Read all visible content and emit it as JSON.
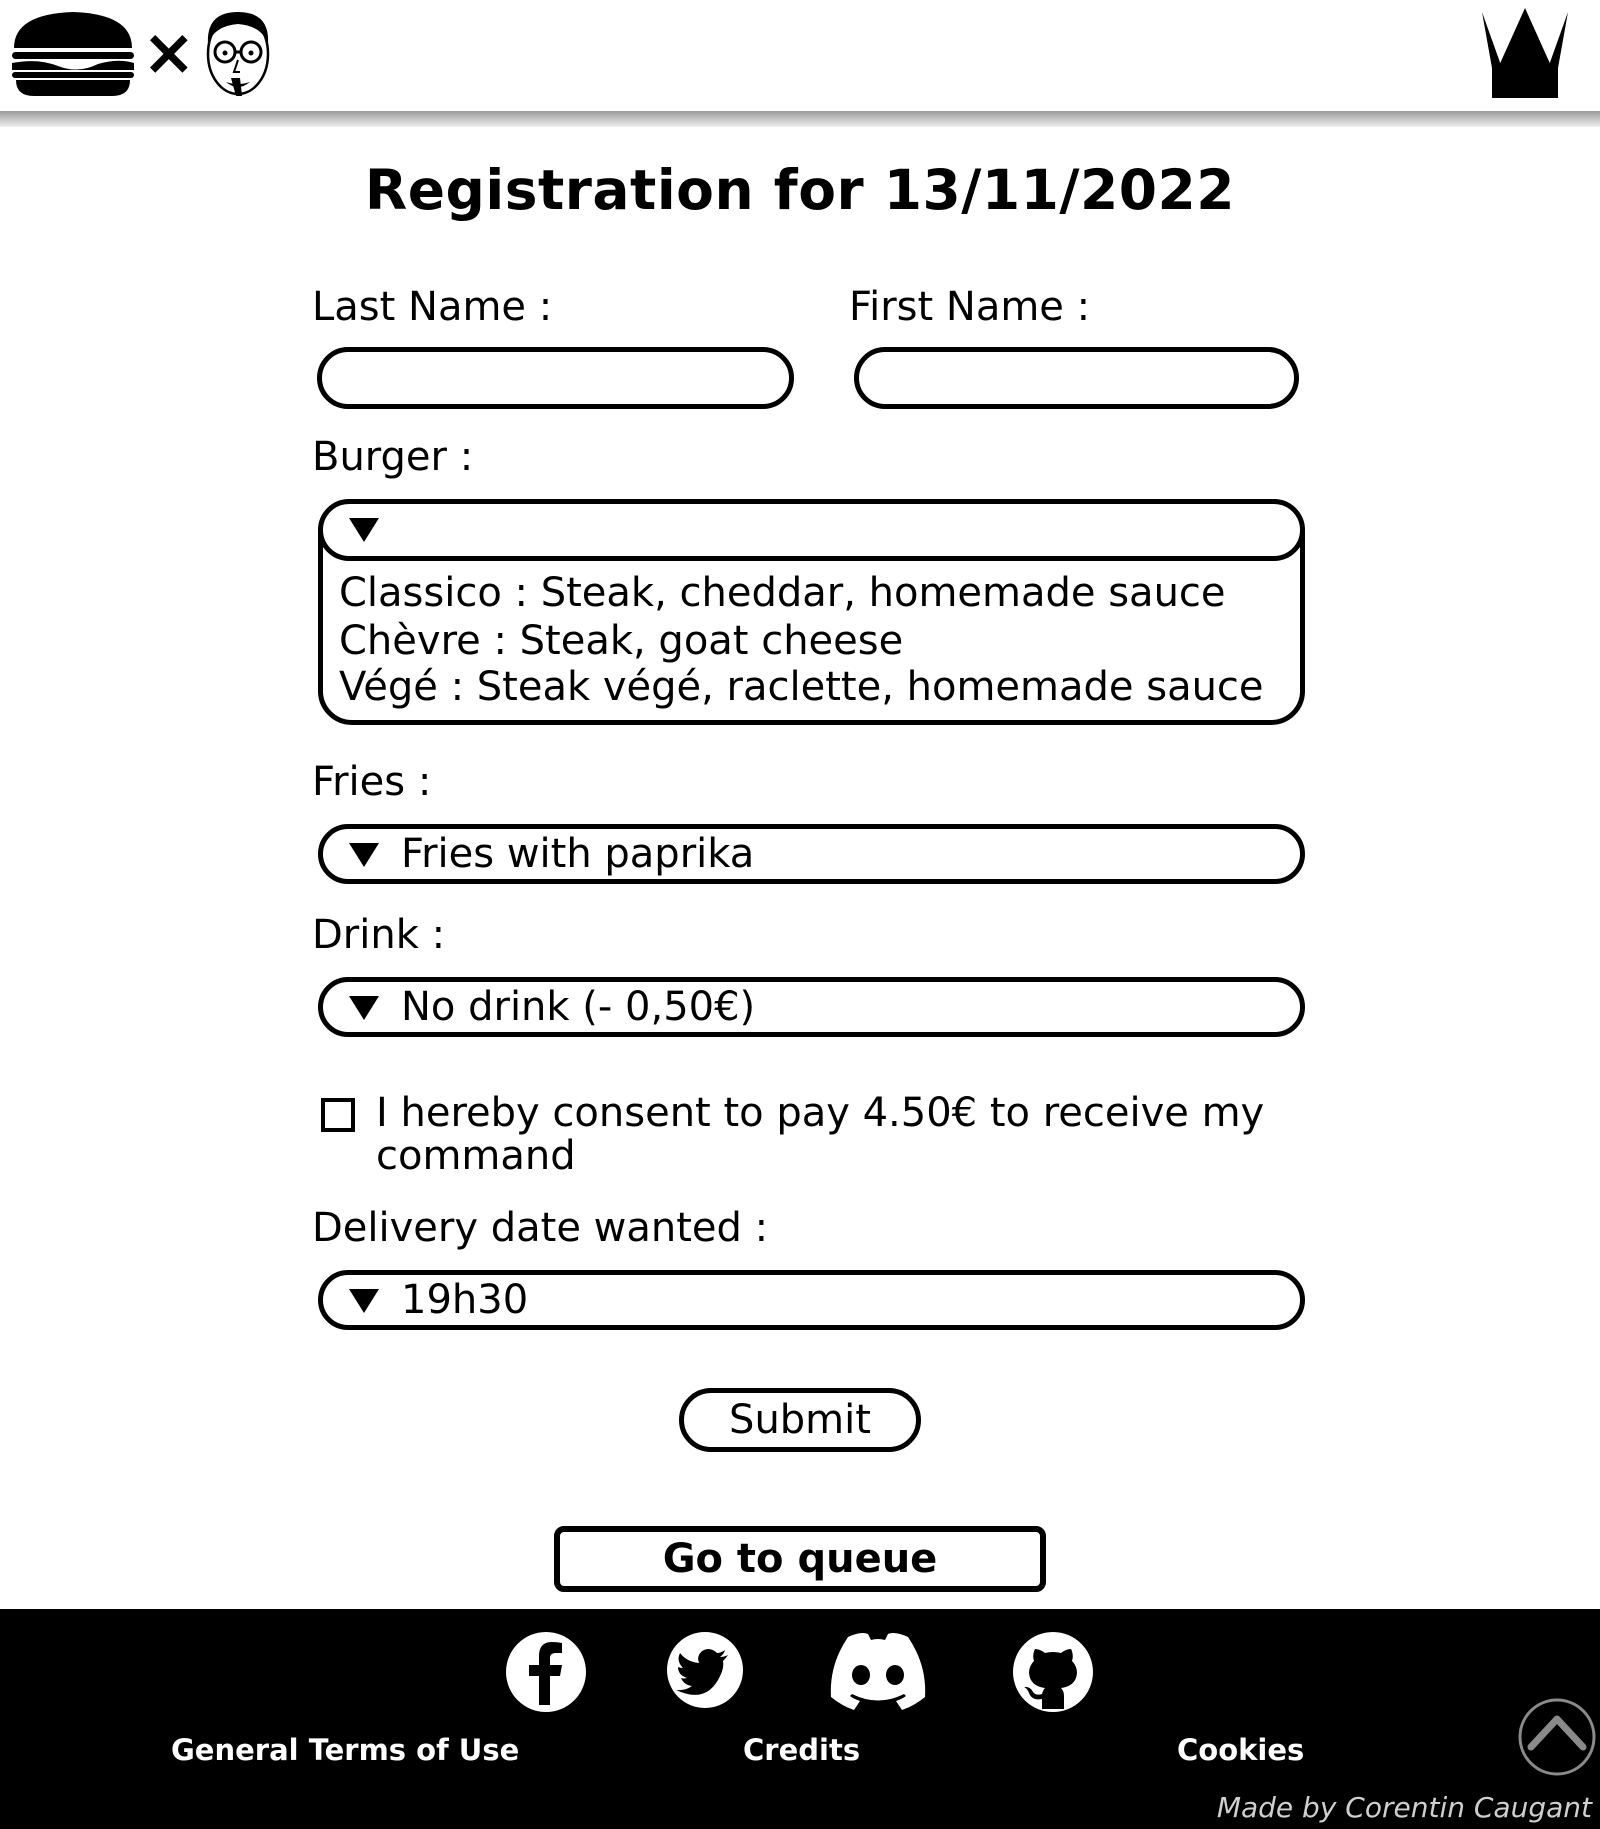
{
  "header": {
    "logo_alt": "Burger x Logo",
    "logo_separator": "×",
    "crown_icon": "crown-icon"
  },
  "form": {
    "title": "Registration for 13/11/2022",
    "last_name_label": "Last Name :",
    "first_name_label": "First Name :",
    "last_name_value": "",
    "first_name_value": "",
    "burger_label": "Burger :",
    "burger_options": [
      "Classico : Steak, cheddar, homemade sauce",
      "Chèvre : Steak, goat cheese",
      "Végé : Steak végé, raclette, homemade sauce"
    ],
    "fries_label": "Fries :",
    "fries_value": "Fries with paprika",
    "drink_label": "Drink :",
    "drink_value": "No drink (- 0,50€)",
    "consent_text": "I hereby consent to pay 4.50€ to receive my command",
    "consent_checked": false,
    "delivery_label": "Delivery date wanted :",
    "delivery_value": "19h30",
    "submit_label": "Submit",
    "queue_label": "Go to queue"
  },
  "footer": {
    "social": [
      "facebook-icon",
      "twitter-icon",
      "discord-icon",
      "github-icon"
    ],
    "links": [
      "General Terms of Use",
      "Credits",
      "Cookies"
    ],
    "made_by": "Made by Corentin Caugant"
  },
  "colors": {
    "background": "#ffffff",
    "foreground": "#000000",
    "footer": "#000000"
  }
}
